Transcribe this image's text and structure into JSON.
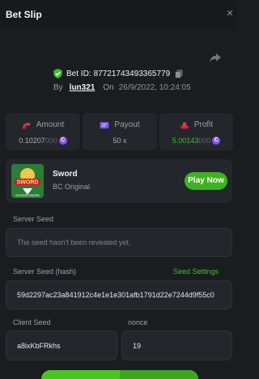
{
  "header": {
    "title": "Bet Slip",
    "close_icon": "close-icon"
  },
  "bet": {
    "id_prefix": "Bet ID:",
    "id_value": "87721743493365779",
    "by_label": "By",
    "user": "lun321",
    "on_label": "On",
    "date": "26/9/2022, 10:24:05"
  },
  "stats": {
    "amount": {
      "label": "Amount",
      "value_main": "0.10207",
      "value_dim": "000",
      "coin": "C"
    },
    "payout": {
      "label": "Payout",
      "value": "50 x"
    },
    "profit": {
      "label": "Profit",
      "value_main": "5.00143",
      "value_dim": "000",
      "coin": "C"
    }
  },
  "game": {
    "name": "Sword",
    "provider": "BC Original",
    "play_label": "Play Now",
    "thumb_word": "SWORD",
    "thumb_sub": "SAVIOUR SWORD"
  },
  "fairness": {
    "server_seed_label": "Server Seed",
    "server_seed_placeholder": "The seed hasn't been revealed yet.",
    "server_seed_hash_label": "Server Seed (hash)",
    "seed_settings_label": "Seed Settings",
    "server_seed_hash_value": "59d2297ac23a841912c4e1e1e301afb1791d22e7244d9f55c0",
    "client_seed_label": "Client Seed",
    "client_seed_value": "a8ixKbFRkhs",
    "nonce_label": "nonce",
    "nonce_value": "19"
  },
  "colors": {
    "accent_green": "#3eb21f",
    "coin_purple": "#8c53f0",
    "background": "#1a1d20",
    "card": "#23272b"
  }
}
